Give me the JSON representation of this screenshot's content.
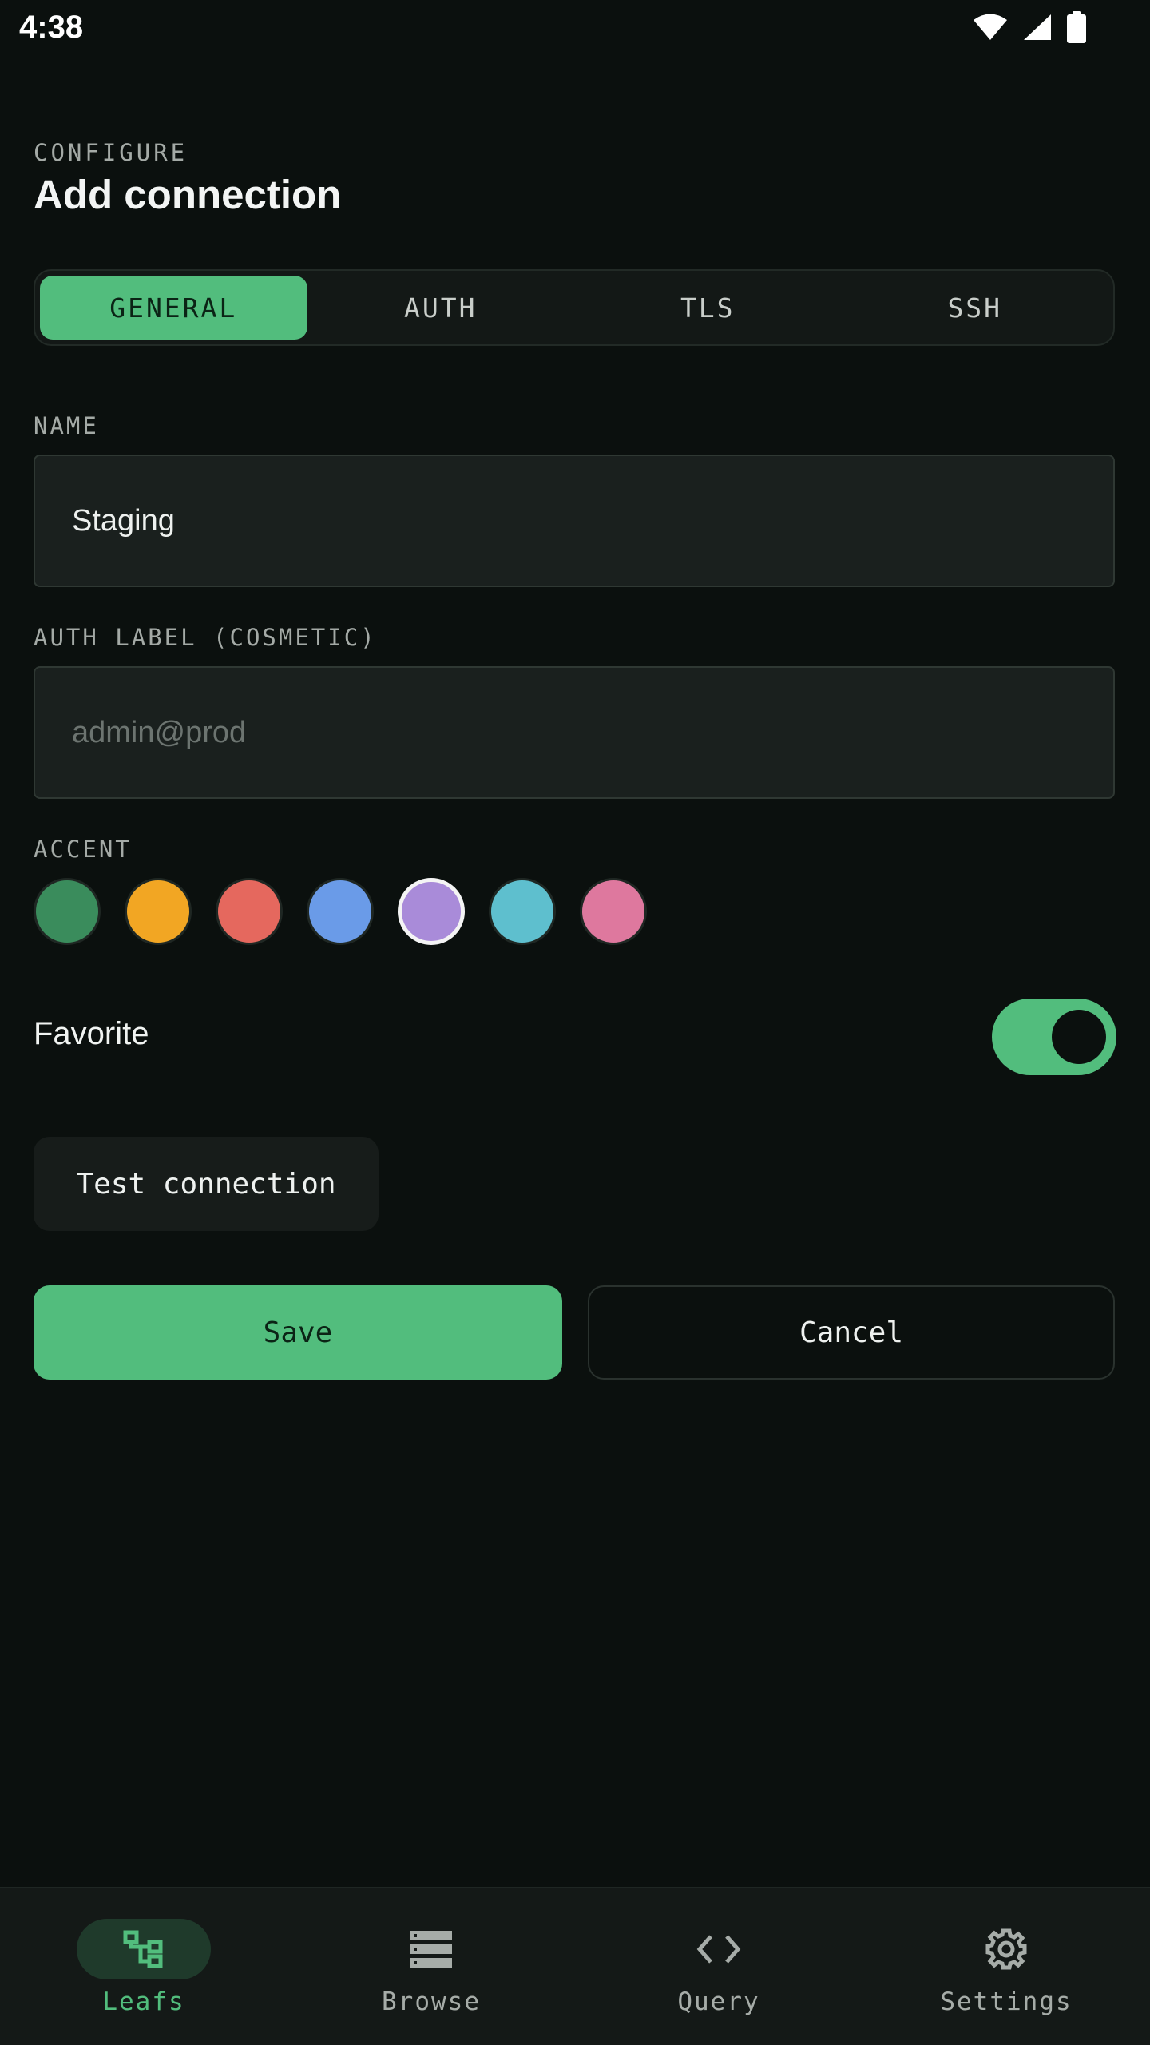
{
  "status_bar": {
    "time": "4:38"
  },
  "header": {
    "eyebrow": "CONFIGURE",
    "title": "Add connection"
  },
  "tabs": [
    {
      "label": "GENERAL",
      "active": true
    },
    {
      "label": "AUTH",
      "active": false
    },
    {
      "label": "TLS",
      "active": false
    },
    {
      "label": "SSH",
      "active": false
    }
  ],
  "form": {
    "name": {
      "label": "NAME",
      "value": "Staging",
      "placeholder": ""
    },
    "auth_label": {
      "label": "AUTH LABEL (COSMETIC)",
      "value": "",
      "placeholder": "admin@prod"
    },
    "accent": {
      "label": "ACCENT",
      "colors": [
        "#3a8c5c",
        "#f2a623",
        "#e5685e",
        "#6a9be8",
        "#a98bd9",
        "#5ebfce",
        "#de789e"
      ],
      "selected_color": "#a98bd9"
    },
    "favorite": {
      "label": "Favorite",
      "on": true
    }
  },
  "actions": {
    "test_label": "Test connection",
    "save_label": "Save",
    "cancel_label": "Cancel"
  },
  "bottom_nav": [
    {
      "label": "Leafs",
      "icon": "tree-icon",
      "active": true
    },
    {
      "label": "Browse",
      "icon": "list-icon",
      "active": false
    },
    {
      "label": "Query",
      "icon": "code-icon",
      "active": false
    },
    {
      "label": "Settings",
      "icon": "gear-icon",
      "active": false
    }
  ],
  "colors": {
    "background": "#0b100e",
    "accent": "#52bd7d",
    "field_bg": "#1a201e"
  }
}
